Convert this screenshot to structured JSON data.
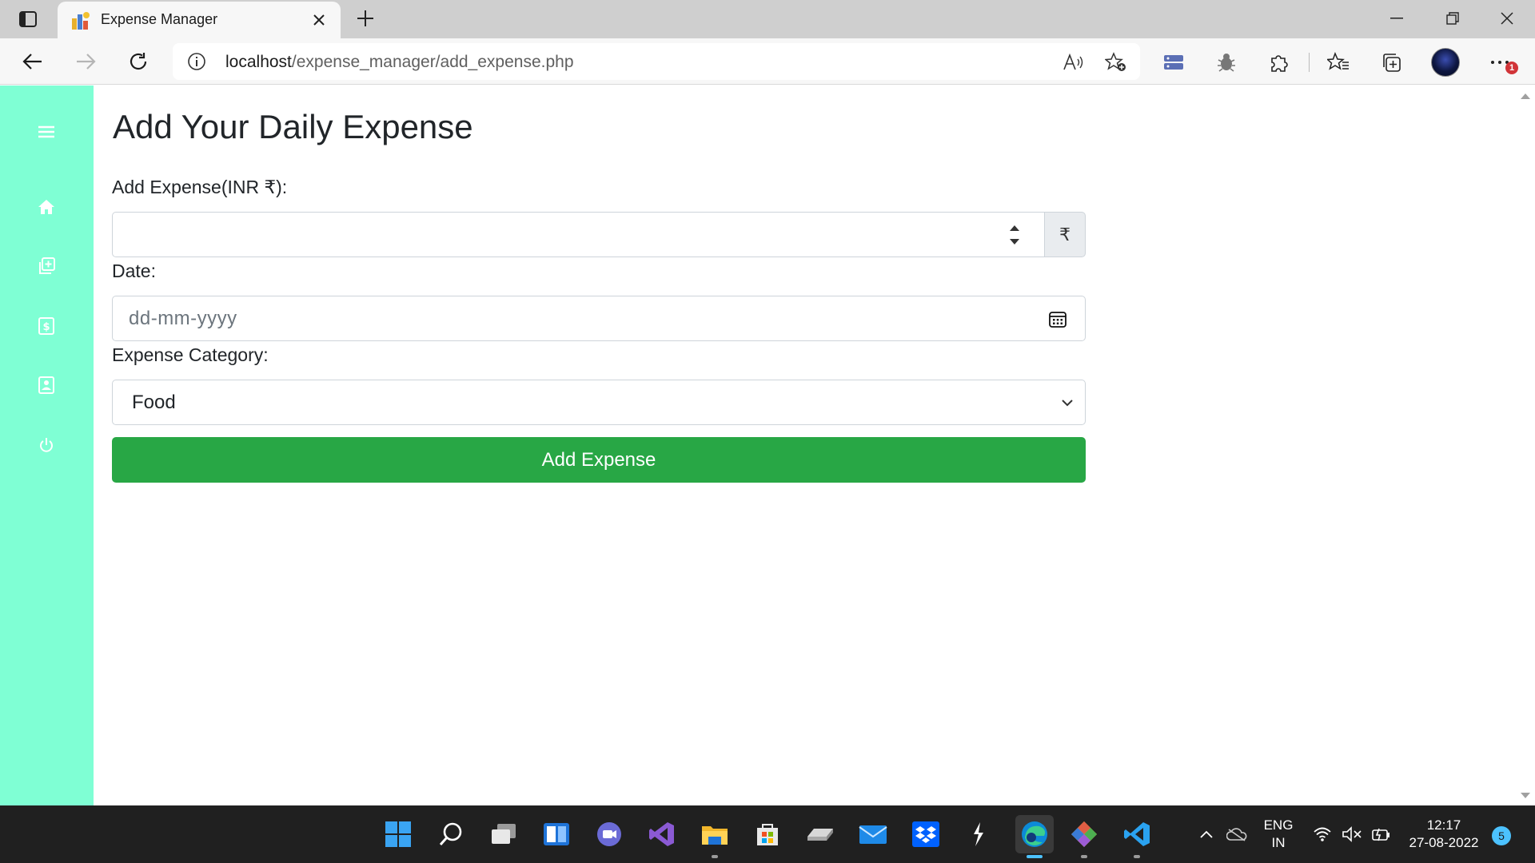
{
  "browser": {
    "tab_title": "Expense Manager",
    "url_host": "localhost",
    "url_path": "/expense_manager/add_expense.php",
    "more_badge": "1"
  },
  "sidebar": {
    "items": [
      {
        "icon": "menu-icon"
      },
      {
        "icon": "home-icon"
      },
      {
        "icon": "add-expense-icon"
      },
      {
        "icon": "manage-expense-icon"
      },
      {
        "icon": "profile-icon"
      },
      {
        "icon": "logout-icon"
      }
    ]
  },
  "form": {
    "title": "Add Your Daily Expense",
    "amount_label": "Add Expense(INR ₹):",
    "amount_value": "",
    "currency_symbol": "₹",
    "date_label": "Date:",
    "date_placeholder": "dd-mm-yyyy",
    "category_label": "Expense Category:",
    "category_value": "Food",
    "submit_label": "Add Expense"
  },
  "colors": {
    "sidebar": "#7fffd4",
    "submit": "#28a745"
  },
  "taskbar": {
    "apps": [
      "start-icon",
      "search-icon",
      "task-view-icon",
      "widgets-icon",
      "teams-chat-icon",
      "visual-studio-icon",
      "file-explorer-icon",
      "microsoft-store-icon",
      "drive-icon",
      "mail-icon",
      "dropbox-icon",
      "sublime-icon",
      "edge-icon",
      "git-icon",
      "vscode-icon"
    ],
    "lang_top": "ENG",
    "lang_bottom": "IN",
    "time": "12:17",
    "date": "27-08-2022",
    "notifications": "5"
  }
}
